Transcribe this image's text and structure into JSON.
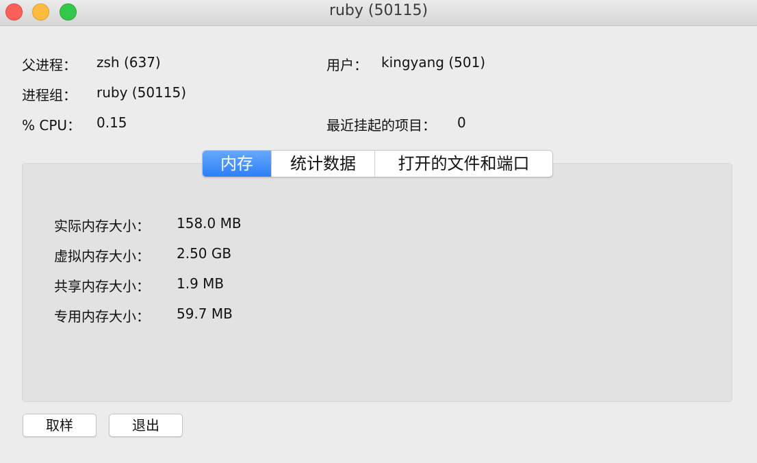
{
  "window": {
    "title": "ruby (50115)",
    "controls": [
      "close",
      "minimize",
      "maximize"
    ]
  },
  "info": {
    "parent_label": "父进程：",
    "parent_value": "zsh (637)",
    "group_label": "进程组：",
    "group_value": "ruby (50115)",
    "cpu_label": "% CPU：",
    "cpu_value": "0.15",
    "user_label": "用户：",
    "user_value": "kingyang (501)",
    "faults_label": "最近挂起的项目：",
    "faults_value": "0"
  },
  "tabs": [
    {
      "label": "内存",
      "selected": true
    },
    {
      "label": "统计数据",
      "selected": false
    },
    {
      "label": "打开的文件和端口",
      "selected": false
    }
  ],
  "memory": [
    {
      "label": "实际内存大小：",
      "value": "158.0 MB"
    },
    {
      "label": "虚拟内存大小：",
      "value": "2.50 GB"
    },
    {
      "label": "共享内存大小：",
      "value": "1.9 MB"
    },
    {
      "label": "专用内存大小：",
      "value": "59.7 MB"
    }
  ],
  "buttons": {
    "sample": "取样",
    "quit": "退出"
  },
  "colors": {
    "accent": "#2c7ff8",
    "window_bg": "#ececec",
    "panel_bg": "#e2e2e2"
  }
}
